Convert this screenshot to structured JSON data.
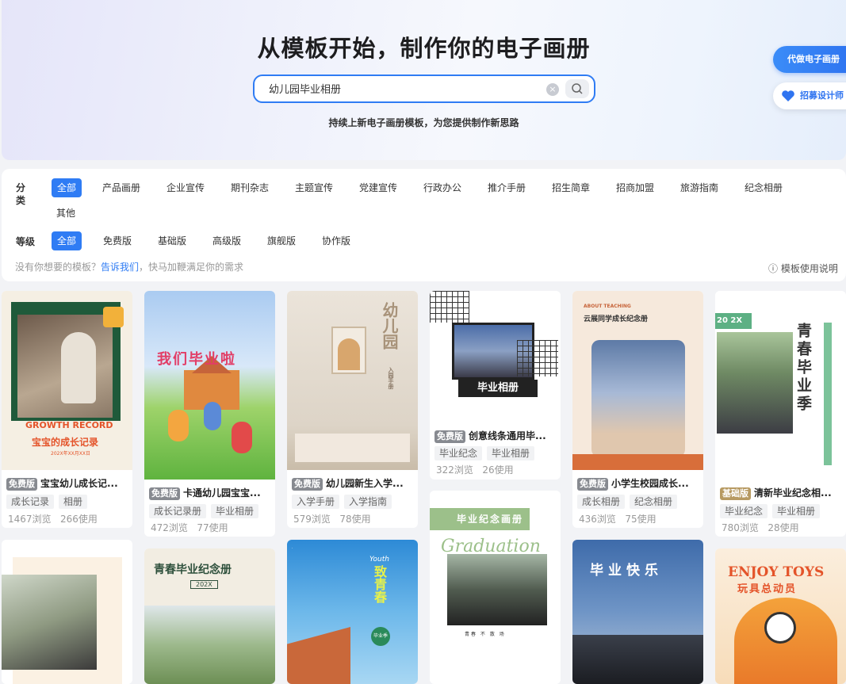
{
  "hero": {
    "title": "从模板开始，制作你的电子画册",
    "search_value": "幼儿园毕业相册",
    "subtitle": "持续上新电子画册模板，为您提供制作新思路",
    "float_primary": "代做电子画册",
    "float_secondary": "招募设计师"
  },
  "filter": {
    "category_label": "分类",
    "categories": [
      "全部",
      "产品画册",
      "企业宣传",
      "期刊杂志",
      "主题宣传",
      "党建宣传",
      "行政办公",
      "推介手册",
      "招生简章",
      "招商加盟",
      "旅游指南",
      "纪念相册",
      "其他"
    ],
    "level_label": "等级",
    "levels": [
      "全部",
      "免费版",
      "基础版",
      "高级版",
      "旗舰版",
      "协作版"
    ],
    "hint_text": "没有你想要的模板？",
    "hint_link": "告诉我们",
    "hint_tail": "，快马加鞭满足你的需求",
    "guide": "模板使用说明"
  },
  "cards": [
    {
      "badge": "免费版",
      "title": "宝宝幼儿成长记...",
      "tags": [
        "成长记录",
        "相册"
      ],
      "views": "1467浏览",
      "uses": "266使用",
      "cover": {
        "en": "GROWTH RECORD",
        "cn": "宝宝的成长记录",
        "small": "202X年XX月XX日"
      }
    },
    {
      "badge": "免费版",
      "title": "卡通幼儿园宝宝...",
      "tags": [
        "成长记录册",
        "毕业相册"
      ],
      "views": "472浏览",
      "uses": "77使用",
      "cover": {
        "cn": "我们毕业啦"
      }
    },
    {
      "badge": "免费版",
      "title": "幼儿园新生入学...",
      "tags": [
        "入学手册",
        "入学指南"
      ],
      "views": "579浏览",
      "uses": "78使用",
      "cover": {
        "cn": "幼儿园",
        "sub": "入园手册"
      }
    },
    {
      "badge": "免费版",
      "title": "创意线条通用毕...",
      "tags": [
        "毕业纪念",
        "毕业相册"
      ],
      "views": "322浏览",
      "uses": "26使用",
      "cover": {
        "cn": "毕业相册"
      }
    },
    {
      "badge": "免费版",
      "title": "小学生校园成长...",
      "tags": [
        "成长相册",
        "纪念相册"
      ],
      "views": "436浏览",
      "uses": "75使用",
      "cover": {
        "en": "ABOUT TEACHING",
        "cn": "云展同学成长纪念册"
      }
    },
    {
      "badge": "基础版",
      "title": "清新毕业纪念相...",
      "tags": [
        "毕业纪念",
        "毕业相册"
      ],
      "views": "780浏览",
      "uses": "28使用",
      "cover": {
        "en": "20 2X TIME",
        "cn": "青春毕业季"
      }
    },
    {
      "cover": {}
    },
    {
      "cover": {
        "cn": "青春毕业纪念册",
        "small": "202X"
      }
    },
    {
      "cover": {
        "en": "Youth",
        "cn": "致青春",
        "sub": "毕业季"
      }
    },
    {
      "cover": {
        "cn": "毕业纪念画册",
        "en": "Graduation",
        "sub": "青春 不 散 场"
      }
    },
    {
      "cover": {
        "cn": "毕业快乐"
      }
    },
    {
      "cover": {
        "en": "ENJOY TOYS",
        "cn": "玩具总动员"
      }
    }
  ],
  "colors": {
    "accent": "#2f7cf4",
    "badge_free": "#878a90",
    "badge_basic": "#b79a62"
  }
}
